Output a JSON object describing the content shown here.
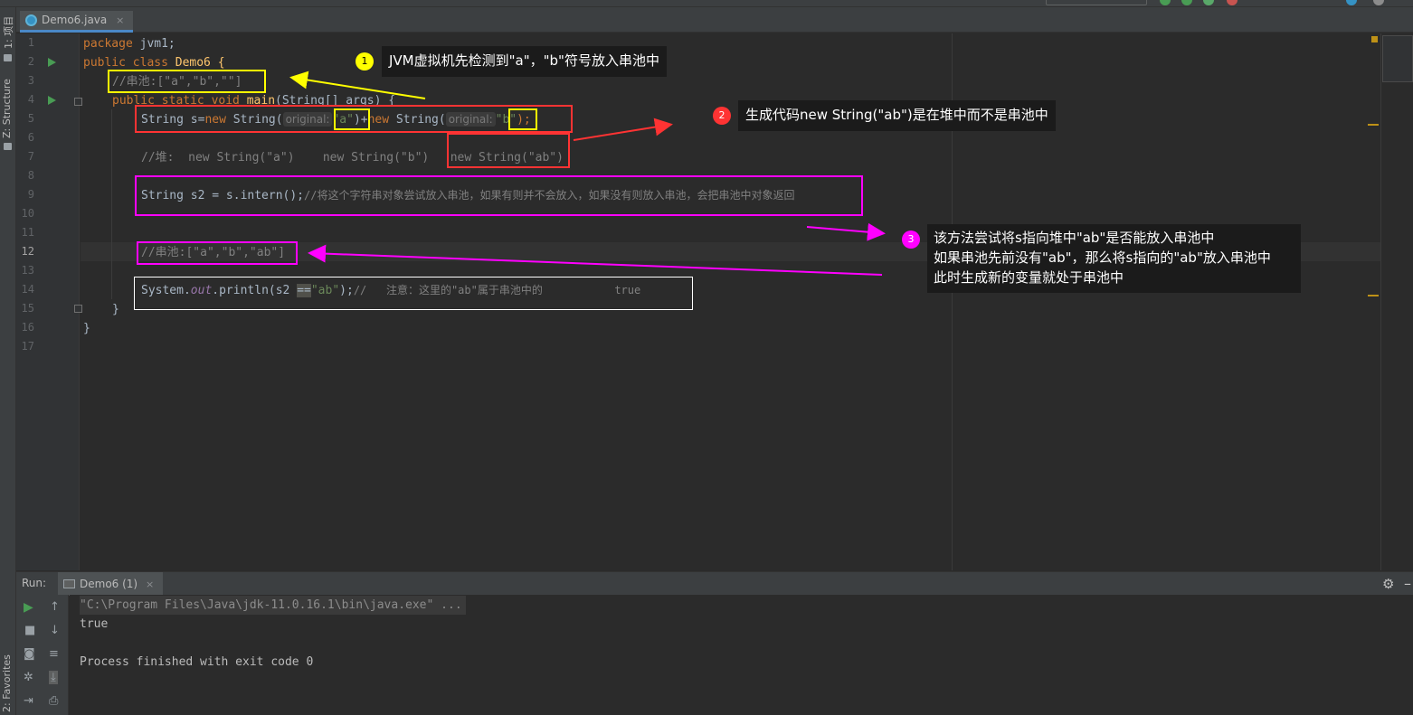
{
  "app": {
    "tab_title": "Demo6.java",
    "tab_close": "×"
  },
  "side_strip": {
    "project_label": "1: 项目",
    "structure_label": "Z: Structure",
    "favorites_label": "2: Favorites"
  },
  "editor": {
    "line_numbers": [
      "1",
      "2",
      "3",
      "4",
      "5",
      "6",
      "7",
      "8",
      "9",
      "10",
      "11",
      "12",
      "13",
      "14",
      "15",
      "16",
      "17"
    ],
    "current_line": "12",
    "code": {
      "l1_kw": "package",
      "l1_rest": " jvm1;",
      "l2_kw": "public class",
      "l2_name": " Demo6 {",
      "l3": "//串池:[\"a\",\"b\",\"\"]",
      "l4_kw": "public static void",
      "l4_name": " main",
      "l4_rest": "(String[] args) {",
      "l5_a": "String s=",
      "l5_b": "new",
      "l5_c": " String(",
      "l5_hint1": "original:",
      "l5_str1": "\"a\"",
      "l5_d": ")+",
      "l5_e": "new",
      "l5_f": " String(",
      "l5_hint2": "original:",
      "l5_str2": "\"b\"",
      "l5_g": ");",
      "l7": "//堆:  new String(\"a\")    new String(\"b\")   new String(\"ab\")",
      "l9_a": "String s2 = s.intern();",
      "l9_cmt": "//将这个字符串对象尝试放入串池，如果有则并不会放入，如果没有则放入串池，会把串池中对象返回",
      "l12": "//串池:[\"a\",\"b\",\"ab\"]",
      "l14_a": "System.",
      "l14_out": "out",
      "l14_b": ".println(s2 ",
      "l14_eq": "==",
      "l14_str": "\"ab\"",
      "l14_c": ");",
      "l14_cmt": "//   注意：这里的\"ab\"属于串池中的           true",
      "l15": "}",
      "l16": "}"
    }
  },
  "annotations": [
    {
      "num": "1",
      "text": "JVM虚拟机先检测到\"a\"，\"b\"符号放入串池中",
      "color": "#ffff00"
    },
    {
      "num": "2",
      "text": "生成代码new String(\"ab\")是在堆中而不是串池中",
      "color": "#ff3333"
    },
    {
      "num": "3",
      "lines": [
        "该方法尝试将s指向堆中\"ab\"是否能放入串池中",
        "如果串池先前没有\"ab\"，那么将s指向的\"ab\"放入串池中",
        "此时生成新的变量就处于串池中"
      ],
      "color": "#ff00ff"
    }
  ],
  "run_panel": {
    "label": "Run:",
    "tab": "Demo6 (1)",
    "tab_close": "×",
    "console": {
      "command": "\"C:\\Program Files\\Java\\jdk-11.0.16.1\\bin\\java.exe\" ...",
      "output": "true",
      "exit": "Process finished with exit code 0"
    }
  },
  "colors": {
    "keyword": "#cc7832",
    "string": "#6a8759",
    "comment": "#808080",
    "method": "#ffc66d"
  }
}
